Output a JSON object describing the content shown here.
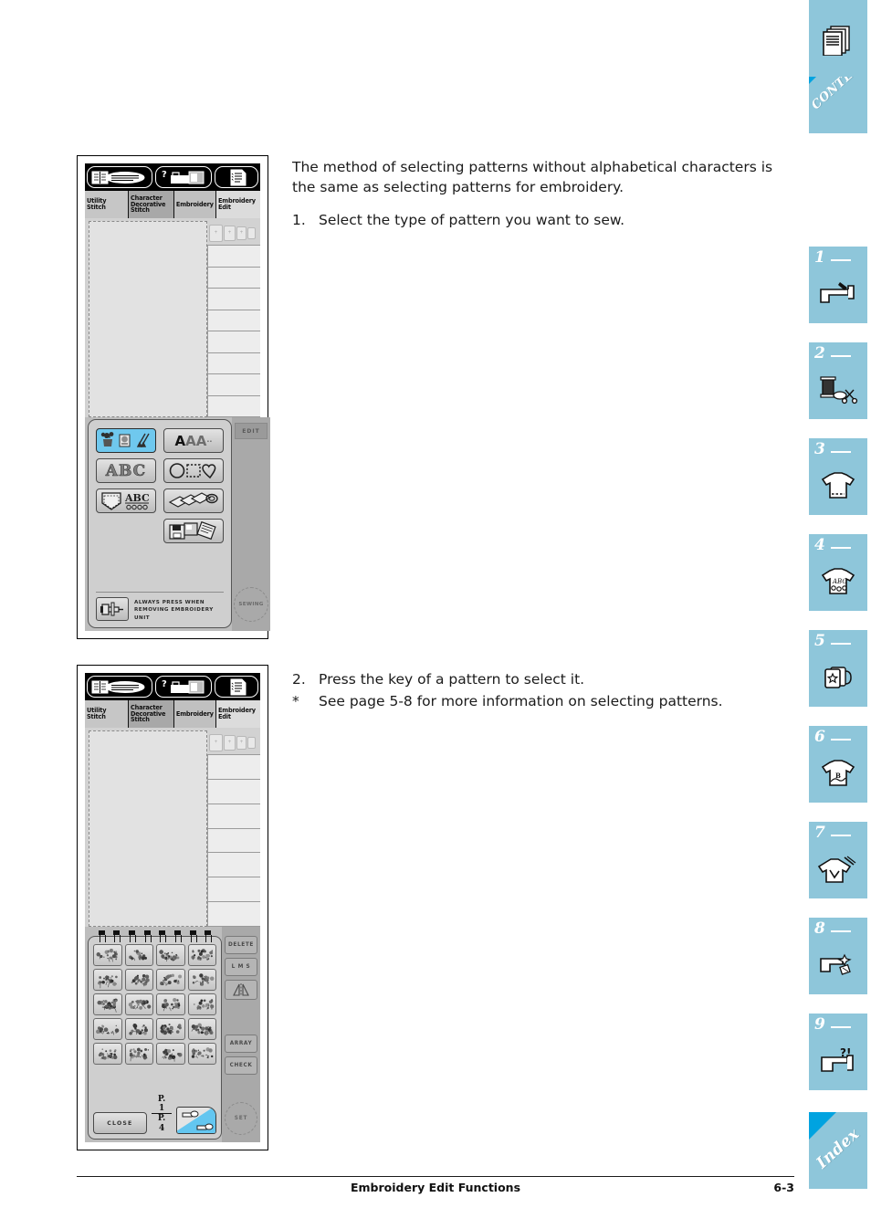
{
  "page": {
    "footer_title": "Embroidery Edit Functions",
    "footer_page": "6-3"
  },
  "instructions": {
    "intro": "The method of selecting patterns without alphabetical characters is the same as selecting patterns for embroidery.",
    "step1_num": "1.",
    "step1_text": "Select the type of pattern you want to sew.",
    "step2_num": "2.",
    "step2_text": "Press the key of a pattern to select it.",
    "note_marker": "*",
    "note_text": "See page 5-8 for more information on selecting patterns."
  },
  "screen1": {
    "tabs": [
      {
        "label": "Utility\nStitch",
        "name": "utility-stitch"
      },
      {
        "label": "Character\nDecorative\nStitch",
        "name": "character-decorative-stitch"
      },
      {
        "label": "Embroidery",
        "name": "embroidery"
      },
      {
        "label": "Embroidery\nEdit",
        "name": "embroidery-edit"
      }
    ],
    "menu_keys": [
      {
        "name": "built-in-patterns-key",
        "icon": "flower-basket-scissors-icon",
        "selected": true
      },
      {
        "name": "font-characters-key",
        "icon": "aaa-font-icon",
        "label": "AAA"
      },
      {
        "name": "decorative-alphabet-key",
        "icon": "abc-outline-icon",
        "label": "ABC"
      },
      {
        "name": "frame-shapes-key",
        "icon": "circle-square-heart-icon"
      },
      {
        "name": "monogram-pocket-key",
        "icon": "pocket-abc-icon",
        "label": "ABC"
      },
      {
        "name": "embroidery-cards-key",
        "icon": "cards-stack-icon"
      },
      {
        "name": "memory-card-key",
        "icon": "floppy-card-icon"
      }
    ],
    "footer_key": {
      "name": "remove-embroidery-unit-key",
      "icon": "carriage-icon"
    },
    "footer_note": "ALWAYS PRESS WHEN\nREMOVING EMBROIDERY\nUNIT",
    "edit_button": "EDIT",
    "sewing_button": "SEWING"
  },
  "screen2": {
    "tabs": [
      {
        "label": "Utility\nStitch",
        "name": "utility-stitch"
      },
      {
        "label": "Character\nDecorative\nStitch",
        "name": "character-decorative-stitch"
      },
      {
        "label": "Embroidery",
        "name": "embroidery"
      },
      {
        "label": "Embroidery\nEdit",
        "name": "embroidery-edit"
      }
    ],
    "pattern_count": 20,
    "patterns": [
      "floral-spray-1",
      "rose-wreath",
      "flower-basket",
      "potted-plant",
      "bouquet-vase",
      "basket-fruit",
      "lily-leaves",
      "bird-branch",
      "small-bloom",
      "tulip-bud",
      "iris-stem",
      "wildflower",
      "boot-flowers",
      "lying-floral",
      "vine-border-1",
      "vine-border-2",
      "flower-row",
      "leaf-cluster",
      "small-blossom",
      "star-flower"
    ],
    "close_button": "CLOSE",
    "page_current": "P. 1",
    "page_total": "P. 4",
    "next_page_key": "next-page-key",
    "side_buttons": [
      {
        "label": "DELETE",
        "name": "delete-button"
      },
      {
        "label": "L M S",
        "name": "size-lms-button"
      },
      {
        "label": "",
        "name": "mirror-button"
      },
      {
        "label": "ARRAY",
        "name": "array-button"
      },
      {
        "label": "CHECK",
        "name": "check-button"
      }
    ],
    "set_button": "SET"
  },
  "rail": {
    "contents_label": "CONTENTS",
    "index_label": "Index",
    "tabs": [
      {
        "num": "1",
        "icon": "sewing-machine-icon"
      },
      {
        "num": "2",
        "icon": "thread-spool-scissors-icon"
      },
      {
        "num": "3",
        "icon": "tshirt-hem-icon"
      },
      {
        "num": "4",
        "icon": "tshirt-abc-icon"
      },
      {
        "num": "5",
        "icon": "card-star-icon"
      },
      {
        "num": "6",
        "icon": "tshirt-embroidery-icon"
      },
      {
        "num": "7",
        "icon": "tshirt-needle-icon"
      },
      {
        "num": "8",
        "icon": "machine-cleaning-icon"
      },
      {
        "num": "9",
        "icon": "machine-question-icon"
      },
      {
        "num": "",
        "icon": "pages-stack-icon"
      }
    ]
  },
  "colors": {
    "rail_blue": "#8ec6da",
    "accent_blue": "#00a3e0",
    "selection_blue": "#6fc8ee",
    "lcd_gray": "#d2d2d2"
  }
}
